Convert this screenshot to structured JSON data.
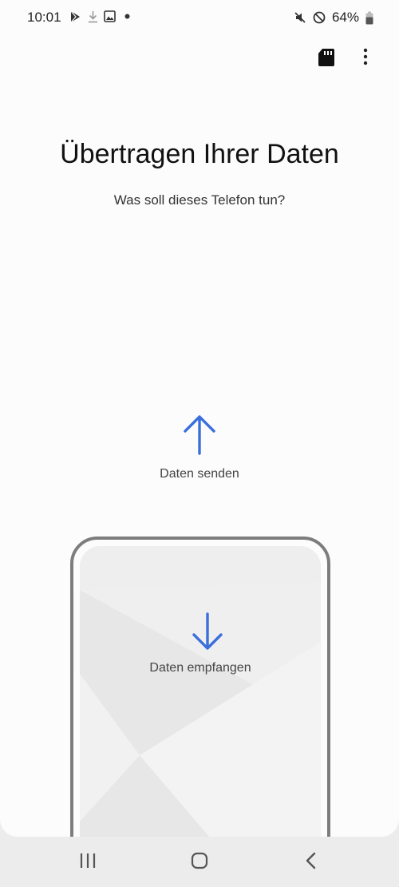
{
  "status_bar": {
    "time": "10:01",
    "battery": "64%",
    "left_icons": [
      "play-store-icon",
      "download-icon",
      "image-icon",
      "dot-icon"
    ],
    "right_icons": [
      "mute-icon",
      "do-not-disturb-icon",
      "battery-icon"
    ]
  },
  "app_bar": {
    "icons": [
      "sd-card-icon",
      "more-options-icon"
    ]
  },
  "main": {
    "title": "Übertragen Ihrer Daten",
    "subtitle": "Was soll dieses Telefon tun?",
    "send_label": "Daten senden",
    "receive_label": "Daten empfangen"
  },
  "colors": {
    "accent": "#3a6fdc",
    "background": "#fcfcfc",
    "phone_frame": "#7d7d7d"
  },
  "nav_bar": {
    "buttons": [
      "recent-apps-icon",
      "home-icon",
      "back-icon"
    ]
  }
}
